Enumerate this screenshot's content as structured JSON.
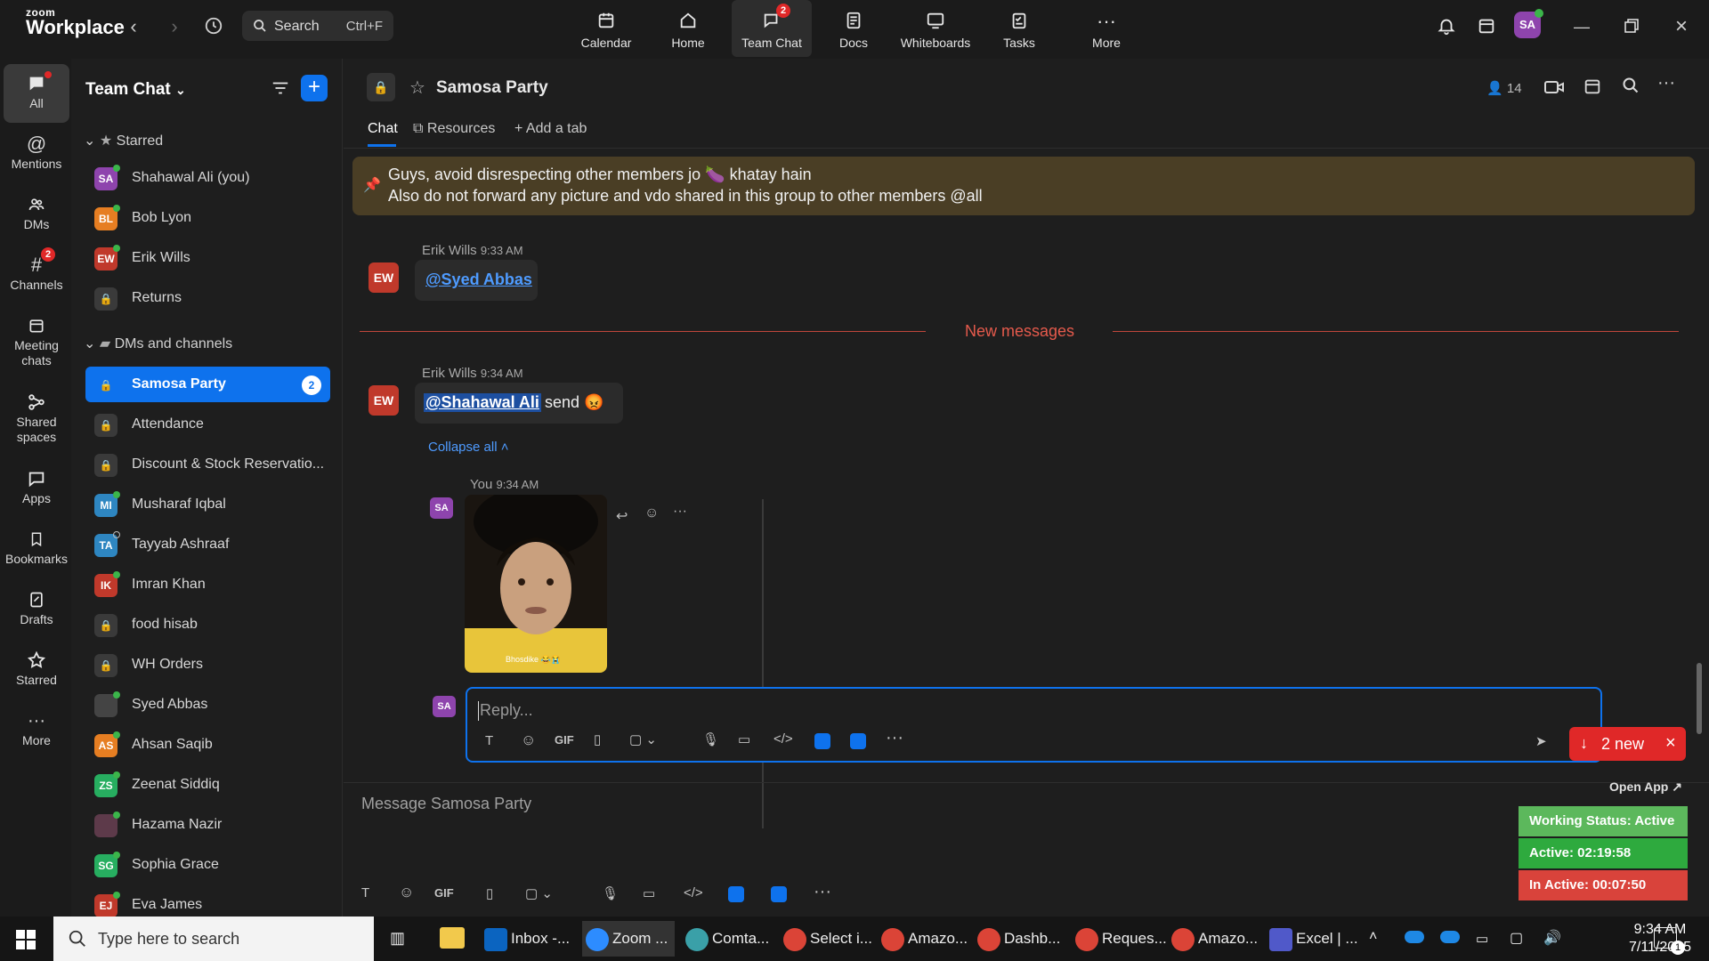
{
  "app": {
    "brand_small": "zoom",
    "brand_big": "Workplace"
  },
  "search": {
    "label": "Search",
    "shortcut": "Ctrl+F"
  },
  "topnav": [
    {
      "label": "Calendar",
      "icon": "calendar-icon"
    },
    {
      "label": "Home",
      "icon": "home-icon"
    },
    {
      "label": "Team Chat",
      "icon": "chat-icon",
      "badge": "2",
      "active": true
    },
    {
      "label": "Docs",
      "icon": "docs-icon"
    },
    {
      "label": "Whiteboards",
      "icon": "whiteboard-icon"
    },
    {
      "label": "Tasks",
      "icon": "tasks-icon"
    },
    {
      "label": "More",
      "icon": "more-icon"
    }
  ],
  "profile": {
    "initials": "SA"
  },
  "rail": [
    {
      "label": "All",
      "active": true
    },
    {
      "label": "Mentions"
    },
    {
      "label": "DMs"
    },
    {
      "label": "Channels",
      "badge": "2"
    },
    {
      "label": "Meeting chats"
    },
    {
      "label": "Shared spaces"
    },
    {
      "label": "Apps"
    },
    {
      "label": "Bookmarks"
    },
    {
      "label": "Drafts"
    },
    {
      "label": "Starred"
    },
    {
      "label": "More"
    }
  ],
  "sidebar": {
    "title": "Team Chat",
    "starred_label": "Starred",
    "starred": [
      {
        "initials": "SA",
        "name": "Shahawal Ali (you)",
        "color": "#8e44ad",
        "online": true
      },
      {
        "initials": "BL",
        "name": "Bob Lyon",
        "color": "#e67e22",
        "online": true
      },
      {
        "initials": "EW",
        "name": "Erik Wills",
        "color": "#c0392b",
        "online": true
      },
      {
        "initials": "",
        "name": "Returns",
        "color": "#3a3a3a",
        "lock": true
      }
    ],
    "dms_label": "DMs and channels",
    "dms": [
      {
        "initials": "",
        "name": "Samosa Party",
        "lock": true,
        "active": true,
        "badge": "2"
      },
      {
        "initials": "",
        "name": "Attendance",
        "lock": true
      },
      {
        "initials": "",
        "name": "Discount & Stock Reservatio...",
        "lock": true
      },
      {
        "initials": "MI",
        "name": "Musharaf Iqbal",
        "color": "#2e86c1",
        "online": true
      },
      {
        "initials": "TA",
        "name": "Tayyab Ashraaf",
        "color": "#2e86c1",
        "online": false
      },
      {
        "initials": "IK",
        "name": "Imran Khan",
        "color": "#c0392b",
        "online": true
      },
      {
        "initials": "",
        "name": "food hisab",
        "lock": true
      },
      {
        "initials": "",
        "name": "WH Orders",
        "lock": true
      },
      {
        "initials": "",
        "name": "Syed Abbas",
        "color": "#444",
        "online": true
      },
      {
        "initials": "AS",
        "name": "Ahsan Saqib",
        "color": "#e67e22",
        "online": true
      },
      {
        "initials": "ZS",
        "name": "Zeenat Siddiq",
        "color": "#27ae60",
        "online": true
      },
      {
        "initials": "",
        "name": "Hazama Nazir",
        "color": "#5d3a4a",
        "online": true
      },
      {
        "initials": "SG",
        "name": "Sophia Grace",
        "color": "#27ae60",
        "online": true
      },
      {
        "initials": "EJ",
        "name": "Eva James",
        "color": "#c0392b",
        "online": true
      }
    ]
  },
  "channel": {
    "title": "Samosa Party",
    "members": "14",
    "tabs": [
      "Chat",
      "Resources",
      "Add a tab"
    ]
  },
  "pinned": {
    "line1": "Guys, avoid disrespecting other members jo 🍆 khatay hain",
    "line2": "Also do not forward any picture and vdo shared in this group to other members @all"
  },
  "messages": [
    {
      "author": "Erik Wills",
      "time": "9:33 AM",
      "initials": "EW",
      "mention": "@Syed Abbas",
      "text": ""
    },
    {
      "author": "Erik Wills",
      "time": "9:34 AM",
      "initials": "EW",
      "mention": "@Shahawal Ali",
      "text": "send 😡"
    }
  ],
  "new_messages_label": "New messages",
  "thread": {
    "collapse_label": "Collapse all",
    "reply_author": "You",
    "reply_time": "9:34 AM",
    "reply_initials": "SA",
    "image_caption": "Bhosdike 😂😭",
    "reply_placeholder": "Reply..."
  },
  "new_pill": {
    "label": "2 new"
  },
  "composer": {
    "placeholder": "Message Samosa Party"
  },
  "overlay": {
    "open_app": "Open App ↗",
    "working": "Working Status: Active",
    "active": "Active: 02:19:58",
    "inactive": "In Active: 00:07:50"
  },
  "taskbar": {
    "search": "Type here to search",
    "apps": [
      {
        "label": "Inbox -...",
        "color": "#0b64c0"
      },
      {
        "label": "Zoom ...",
        "color": "#2d8cff",
        "active": true
      },
      {
        "label": "Comta...",
        "color": "#3aa0a8"
      },
      {
        "label": "Select i...",
        "color": "#db4437"
      },
      {
        "label": "Amazo...",
        "color": "#db4437"
      },
      {
        "label": "Dashb...",
        "color": "#db4437"
      },
      {
        "label": "Reques...",
        "color": "#db4437"
      },
      {
        "label": "Amazo...",
        "color": "#db4437"
      },
      {
        "label": "Excel | ...",
        "color": "#5059c9"
      }
    ],
    "time": "9:34 AM",
    "date": "7/11/2025",
    "notif": "1"
  }
}
